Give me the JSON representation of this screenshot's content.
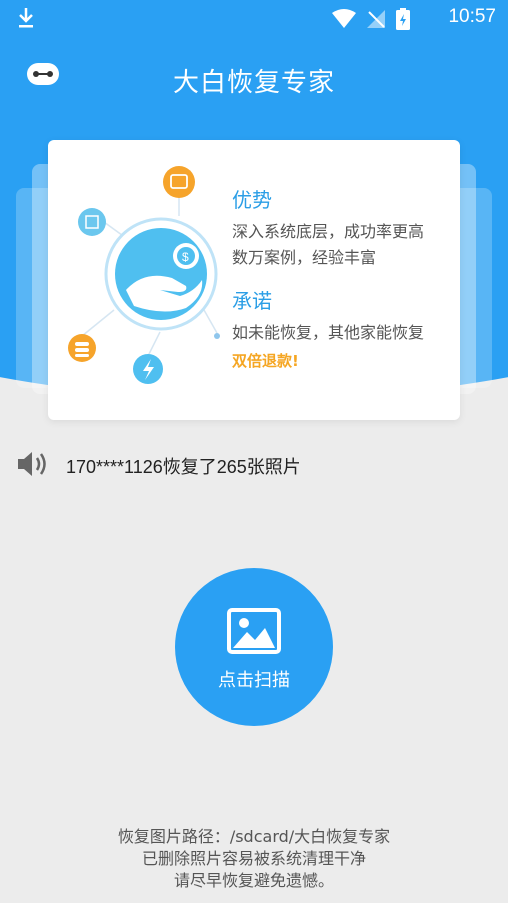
{
  "status_bar": {
    "time": "10:57"
  },
  "app": {
    "title": "大白恢复专家"
  },
  "card": {
    "advantage_title": "优势",
    "advantage_line1": "深入系统底层，成功率更高",
    "advantage_line2": "数万案例，经验丰富",
    "promise_title": "承诺",
    "promise_line1": "如未能恢复，其他家能恢复",
    "promise_highlight": "双倍退款!"
  },
  "notice": {
    "text": "170****1126恢复了265张照片"
  },
  "scan": {
    "label": "点击扫描"
  },
  "footer": {
    "line1": "恢复图片路径：/sdcard/大白恢复专家",
    "line2": "已删除照片容易被系统清理干净",
    "line3": "请尽早恢复避免遗憾。"
  },
  "colors": {
    "primary": "#2aa0f3",
    "accent": "#f5a623",
    "background": "#ececec"
  }
}
